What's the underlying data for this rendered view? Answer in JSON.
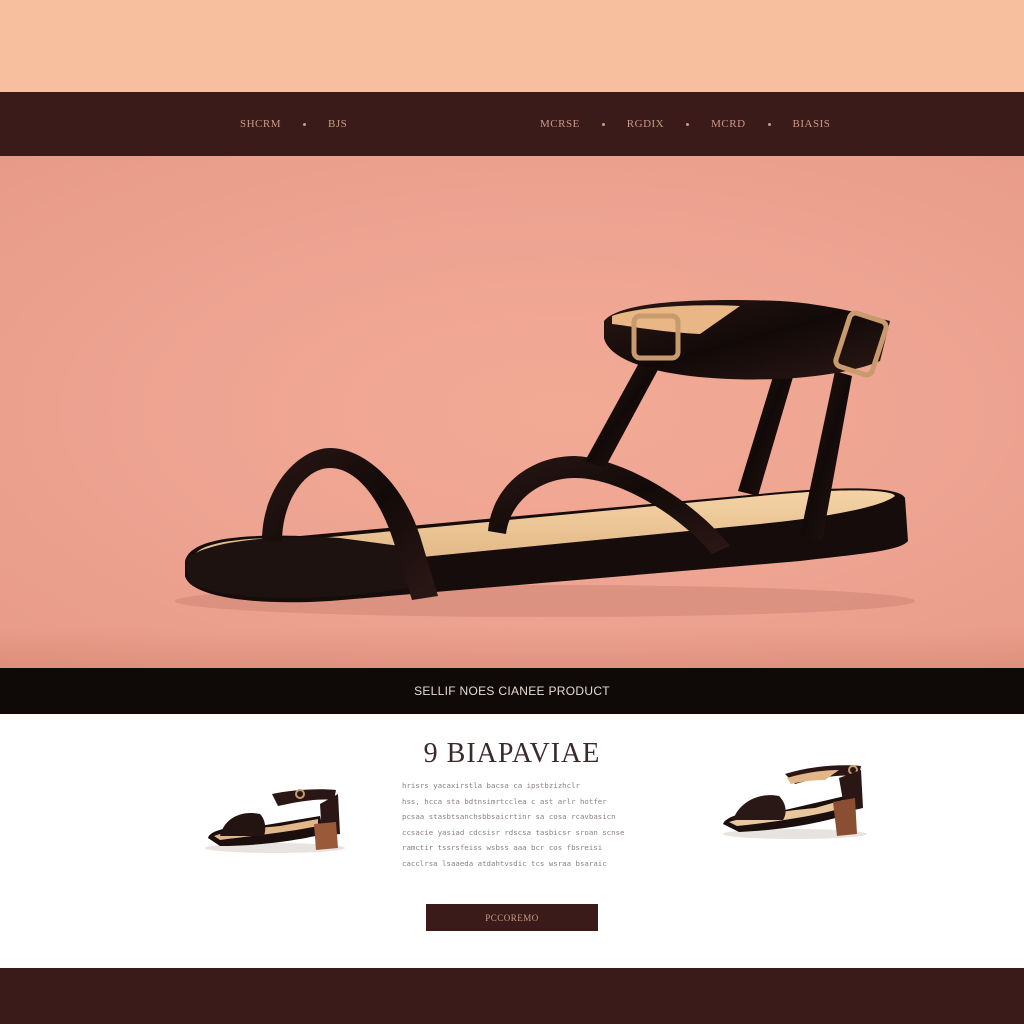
{
  "nav": {
    "left_items": [
      "SHCRM",
      "BJS"
    ],
    "right_items": [
      "MCRSE",
      "RGDIX",
      "MCRD",
      "BIASIS"
    ]
  },
  "hero": {
    "image": "sandal-hero-image"
  },
  "banner": {
    "text": "SELLIF NOES CIANEE PRODUCT"
  },
  "product": {
    "title": "9 BIAPAVIAE",
    "description_lines": [
      "hrisrs yacaxirstla bacsa ca ipstbzizhclr",
      "hss, hcca sta bdtnsimrtcclea c ast arlr hotfer",
      "pcsaa stasbtsanchsbbsaicrtinr sa cosa rcavbasicn",
      "ccsacie yasiad cdcsisr rdscsa tasbicsr sroan scnse",
      "ramctir tssrsfeiss wsbss aaa bcr cos fbsreisi",
      "cacclrsa lsaaeda atdahtvsdic tcs wsraa bsaraic"
    ],
    "cta_label": "PCCOREMO"
  },
  "colors": {
    "brand_dark": "#3a1b19",
    "hero_bg": "#eda391",
    "top_band": "#f8bf9f",
    "banner_bg": "#0f0908",
    "accent_text": "#c99a86"
  }
}
